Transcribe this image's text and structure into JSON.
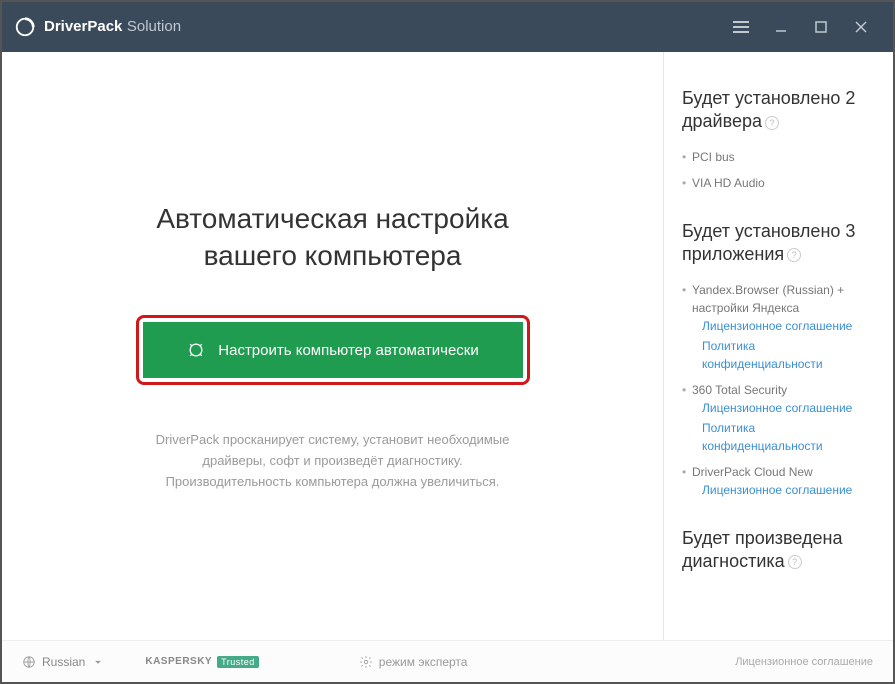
{
  "titlebar": {
    "brand_bold": "DriverPack",
    "brand_light": "Solution"
  },
  "main": {
    "title_line1": "Автоматическая настройка",
    "title_line2": "вашего компьютера",
    "primary_btn": "Настроить компьютер автоматически",
    "desc_line1": "DriverPack просканирует систему, установит необходимые",
    "desc_line2": "драйверы, софт и произведёт диагностику.",
    "desc_line3": "Производительность компьютера должна увеличиться."
  },
  "sidebar": {
    "drivers_heading": "Будет установлено 2 драйвера",
    "drivers": [
      "PCI bus",
      "VIA HD Audio"
    ],
    "apps_heading": "Будет установлено 3 приложения",
    "app1_name": "Yandex.Browser (Russian) + настройки Яндекса",
    "app1_link1": "Лицензионное соглашение",
    "app1_link2": "Политика конфиденциальности",
    "app2_name": "360 Total Security",
    "app2_link1": "Лицензионное соглашение",
    "app2_link2": "Политика конфиденциальности",
    "app3_name": "DriverPack Cloud New",
    "app3_link1": "Лицензионное соглашение",
    "diag_heading": "Будет произведена диагностика"
  },
  "footer": {
    "language": "Russian",
    "kaspersky": "KASPERSKY",
    "trusted": "Trusted",
    "expert_mode": "режим эксперта",
    "license": "Лицензионное соглашение"
  }
}
